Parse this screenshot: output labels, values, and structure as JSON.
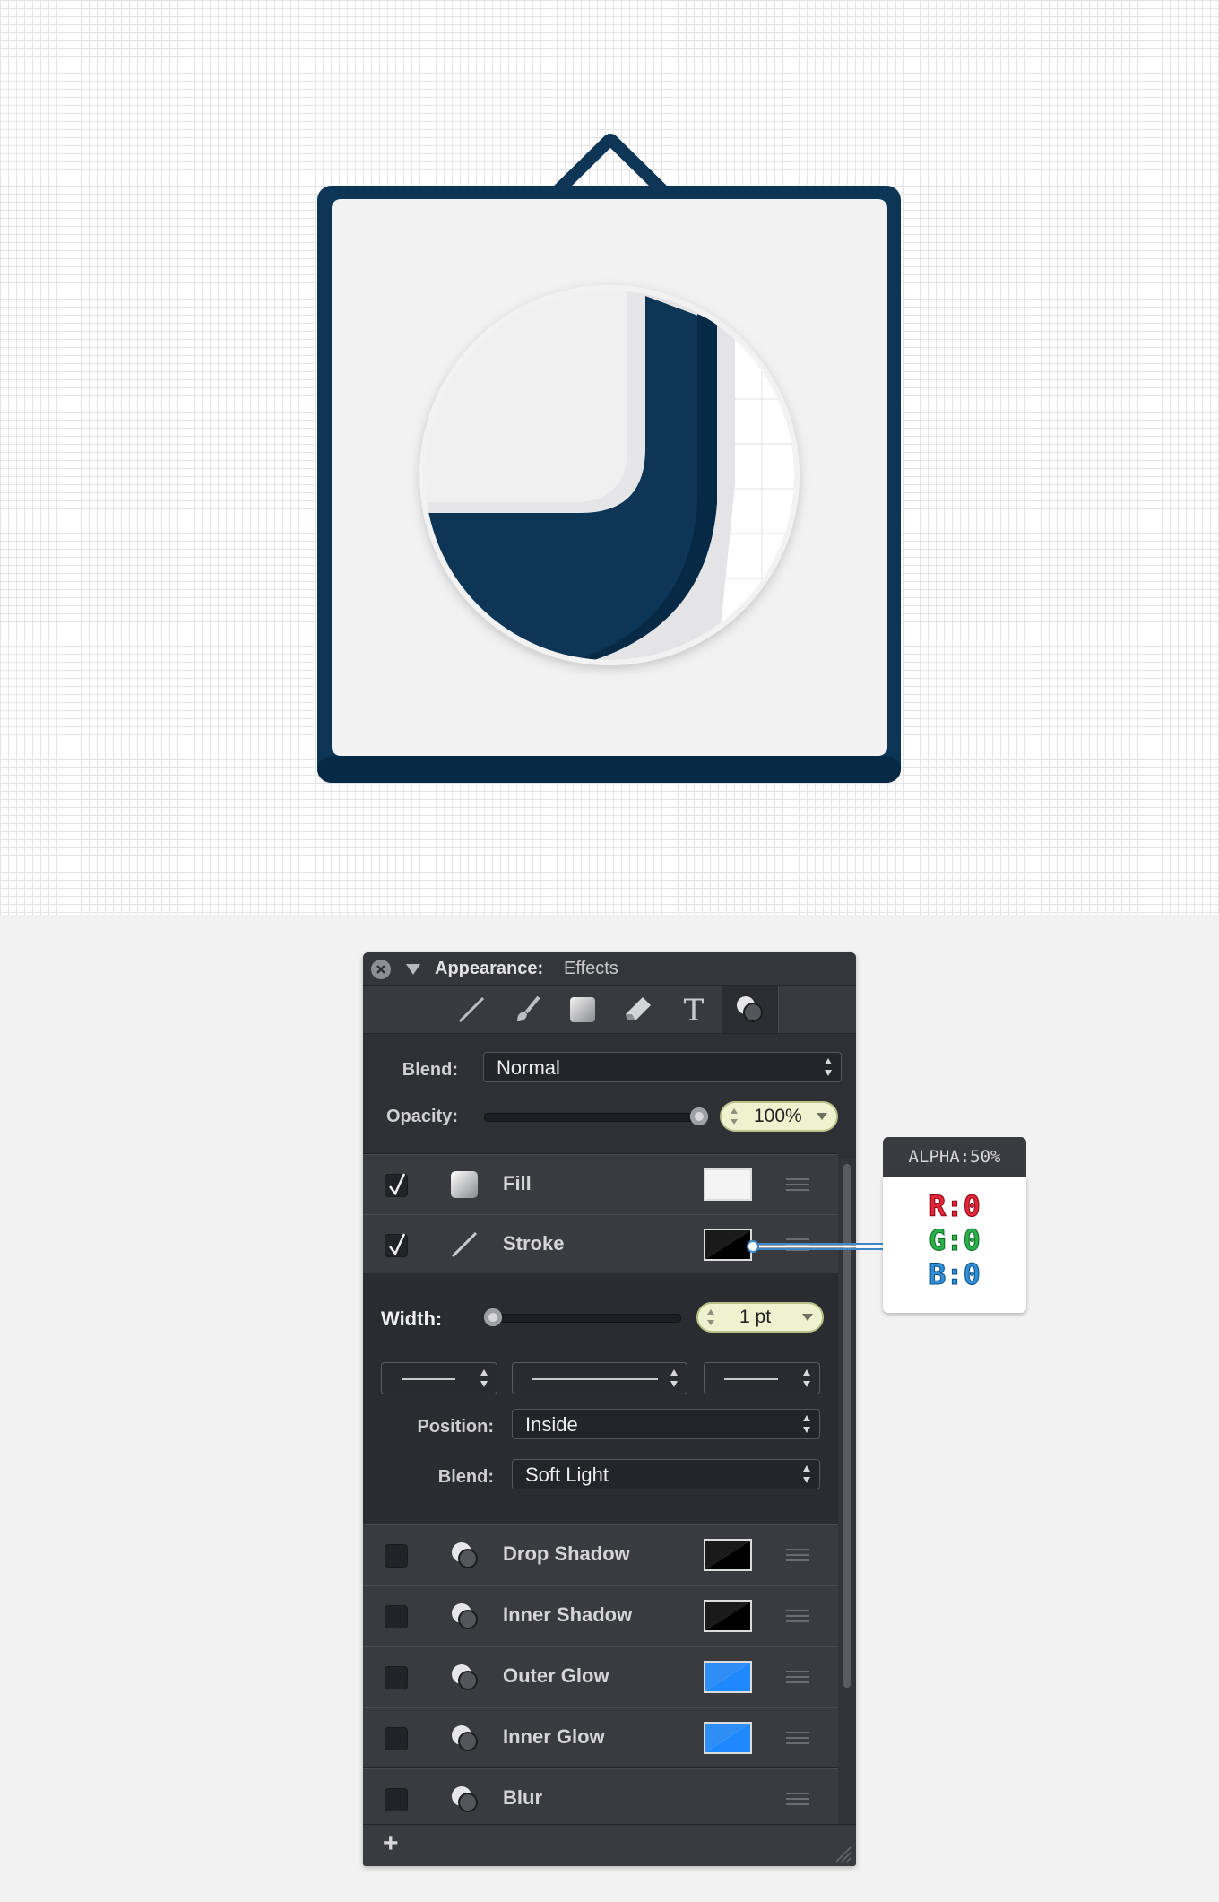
{
  "panel": {
    "title": "Appearance:",
    "subtitle": "Effects",
    "tools": [
      "stroke-tool-icon",
      "brush-tool-icon",
      "fill-tool-icon",
      "eraser-tool-icon",
      "text-tool-icon",
      "effects-tool-icon"
    ],
    "blend_label": "Blend:",
    "blend_value": "Normal",
    "opacity_label": "Opacity:",
    "opacity_value": "100%",
    "opacity_fraction": 1.0,
    "fill": {
      "name": "Fill",
      "checked": true,
      "color": "#ffffff"
    },
    "stroke": {
      "name": "Stroke",
      "checked": true,
      "color": "#000000"
    },
    "width_label": "Width:",
    "width_value": "1 pt",
    "width_fraction": 0.0,
    "position_label": "Position:",
    "position_value": "Inside",
    "stroke_blend_label": "Blend:",
    "stroke_blend_value": "Soft Light",
    "effects": [
      {
        "name": "Drop Shadow",
        "checked": false,
        "color": "#000000"
      },
      {
        "name": "Inner Shadow",
        "checked": false,
        "color": "#000000"
      },
      {
        "name": "Outer Glow",
        "checked": false,
        "color": "#1e88ff"
      },
      {
        "name": "Inner Glow",
        "checked": false,
        "color": "#1e88ff"
      },
      {
        "name": "Blur",
        "checked": false,
        "color": ""
      }
    ],
    "add_label": "+"
  },
  "callout": {
    "header": "ALPHA:50%",
    "r": "R:0",
    "g": "G:0",
    "b": "B:0"
  },
  "colors": {
    "navy": "#0c3556",
    "navy_dark": "#062a46",
    "panel_bg": "#2f3033",
    "accent_blue": "#1e88ff"
  }
}
